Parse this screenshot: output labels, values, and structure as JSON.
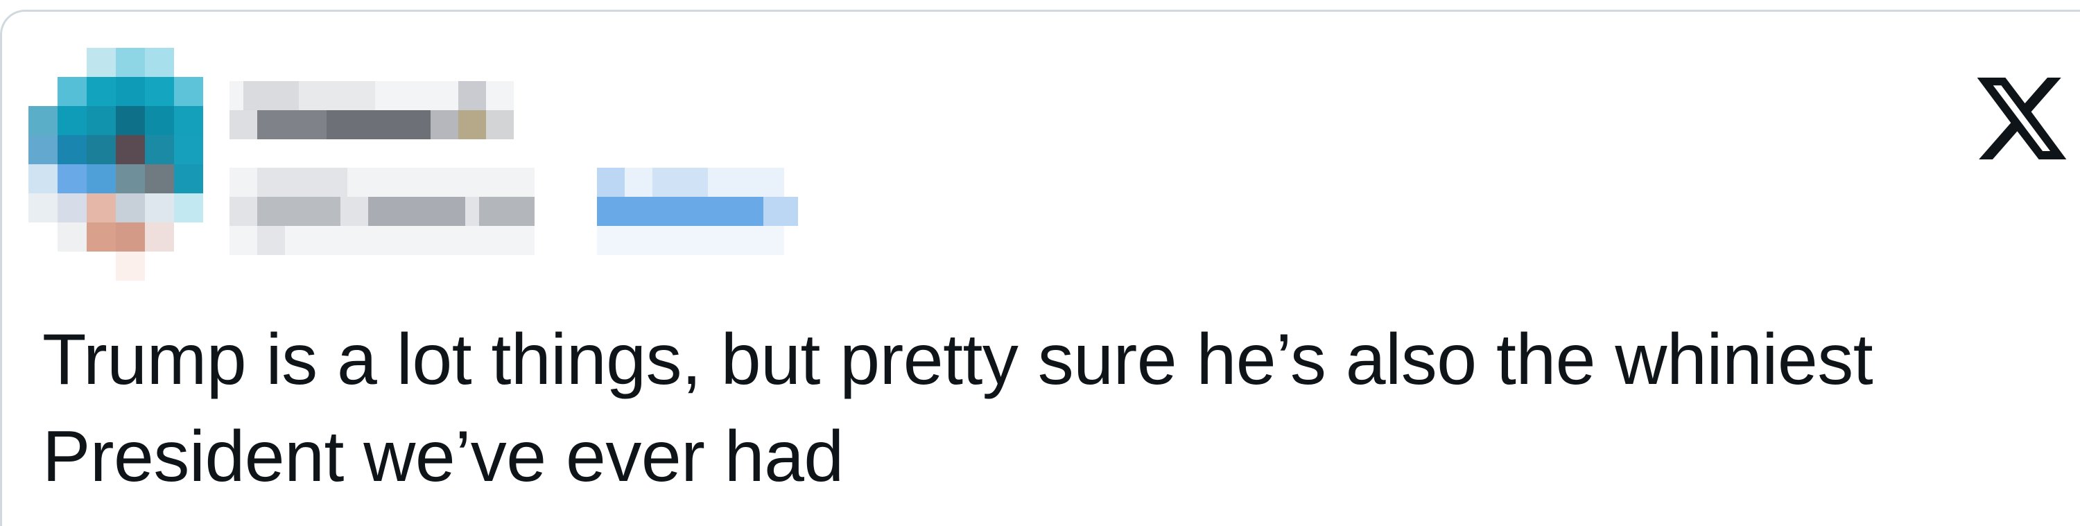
{
  "post": {
    "text_line_1": "Trump is a lot things, but pretty sure he’s also the whiniest",
    "text_line_2": "President we’ve ever had"
  },
  "platform": {
    "logo_icon": "x-logo-icon"
  },
  "colors": {
    "text": "#0f1419",
    "border": "#cfd9de",
    "avatar_teal": "#12a3bf",
    "handle_blue": "#6aa9e8"
  }
}
